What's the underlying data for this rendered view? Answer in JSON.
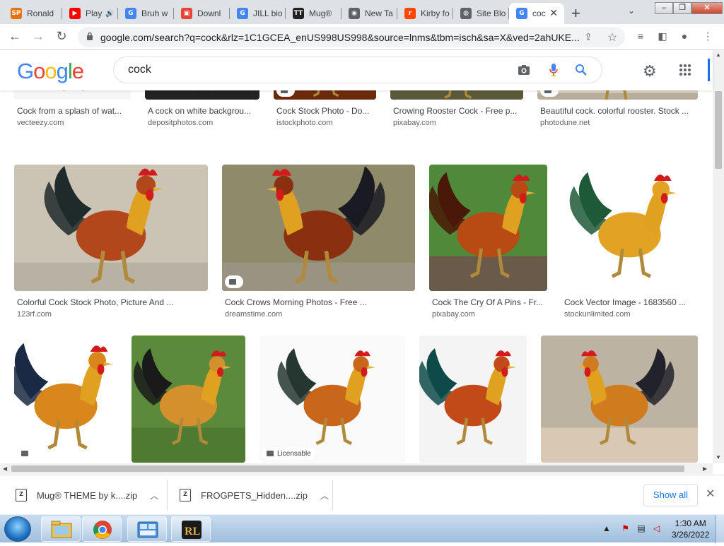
{
  "tabs": [
    {
      "title": "Ronald",
      "fav_text": "SP",
      "fav_color": "#e8710a"
    },
    {
      "title": "Play",
      "fav_text": "▶",
      "fav_color": "#ff0000",
      "audio": "🔊"
    },
    {
      "title": "Bruh w",
      "fav_text": "G",
      "fav_color": "#4285f4"
    },
    {
      "title": "Downl",
      "fav_text": "▣",
      "fav_color": "#ea4335"
    },
    {
      "title": "JILL bio",
      "fav_text": "G",
      "fav_color": "#4285f4"
    },
    {
      "title": "Mug®",
      "fav_text": "TT",
      "fav_color": "#222222"
    },
    {
      "title": "New Ta",
      "fav_text": "◉",
      "fav_color": "#5f6368"
    },
    {
      "title": "Kirby fo",
      "fav_text": "r",
      "fav_color": "#ff4500"
    },
    {
      "title": "Site Blo",
      "fav_text": "◍",
      "fav_color": "#5f6368"
    },
    {
      "title": "coc",
      "fav_text": "G",
      "fav_color": "#4285f4"
    }
  ],
  "window": {
    "minimize": "–",
    "restore": "❐",
    "close": "✕",
    "new_tab": "+",
    "tab_search": "⌄"
  },
  "address_bar": {
    "url": "google.com/search?q=cock&rlz=1C1GCEA_enUS998US998&source=lnms&tbm=isch&sa=X&ved=2ahUKE..."
  },
  "toolbar_icons": [
    "back-icon",
    "forward-icon",
    "reload-icon",
    "share-icon",
    "star-icon",
    "media-icon",
    "sidepanel-icon",
    "profile-icon",
    "menu-icon"
  ],
  "google": {
    "logo": [
      "G",
      "o",
      "o",
      "g",
      "l",
      "e"
    ],
    "logo_colors": [
      "#4285f4",
      "#ea4335",
      "#fbbc05",
      "#4285f4",
      "#34a853",
      "#ea4335"
    ],
    "query": "cock"
  },
  "results": [
    {
      "title": "Cock from a splash of wat...",
      "source": "vecteezy.com",
      "badge": false,
      "licensable": ""
    },
    {
      "title": "A cock on white backgrou...",
      "source": "depositphotos.com",
      "badge": false,
      "licensable": ""
    },
    {
      "title": "Cock Stock Photo - Do...",
      "source": "istockphoto.com",
      "badge": true,
      "licensable": ""
    },
    {
      "title": "Crowing Rooster Cock - Free p...",
      "source": "pixabay.com",
      "badge": false,
      "licensable": ""
    },
    {
      "title": "Beautiful cock. colorful rooster. Stock ...",
      "source": "photodune.net",
      "badge": true,
      "licensable": ""
    },
    {
      "title": "Colorful Cock Stock Photo, Picture And ...",
      "source": "123rf.com",
      "badge": false,
      "licensable": ""
    },
    {
      "title": "Cock Crows Morning Photos - Free ...",
      "source": "dreamstime.com",
      "badge": true,
      "licensable": ""
    },
    {
      "title": "Cock The Cry Of A Pins - Fr...",
      "source": "pixabay.com",
      "badge": false,
      "licensable": ""
    },
    {
      "title": "Cock Vector Image - 1683560 ...",
      "source": "stockunlimited.com",
      "badge": false,
      "licensable": ""
    },
    {
      "title": "",
      "source": "",
      "badge": true,
      "licensable": ""
    },
    {
      "title": "",
      "source": "",
      "badge": false,
      "licensable": ""
    },
    {
      "title": "",
      "source": "",
      "badge": true,
      "licensable": "Licensable"
    },
    {
      "title": "",
      "source": "",
      "badge": false,
      "licensable": ""
    },
    {
      "title": "",
      "source": "",
      "badge": false,
      "licensable": ""
    }
  ],
  "downloads": {
    "items": [
      {
        "name": "Mug® THEME by k....zip"
      },
      {
        "name": "FROGPETS_Hidden....zip"
      }
    ],
    "show_all": "Show all",
    "close": "✕"
  },
  "taskbar": {
    "time": "1:30 AM",
    "date": "3/26/2022",
    "apps": [
      "file-explorer-icon",
      "chrome-icon",
      "control-panel-icon",
      "roblox-launcher-icon"
    ],
    "tray": "▲"
  }
}
